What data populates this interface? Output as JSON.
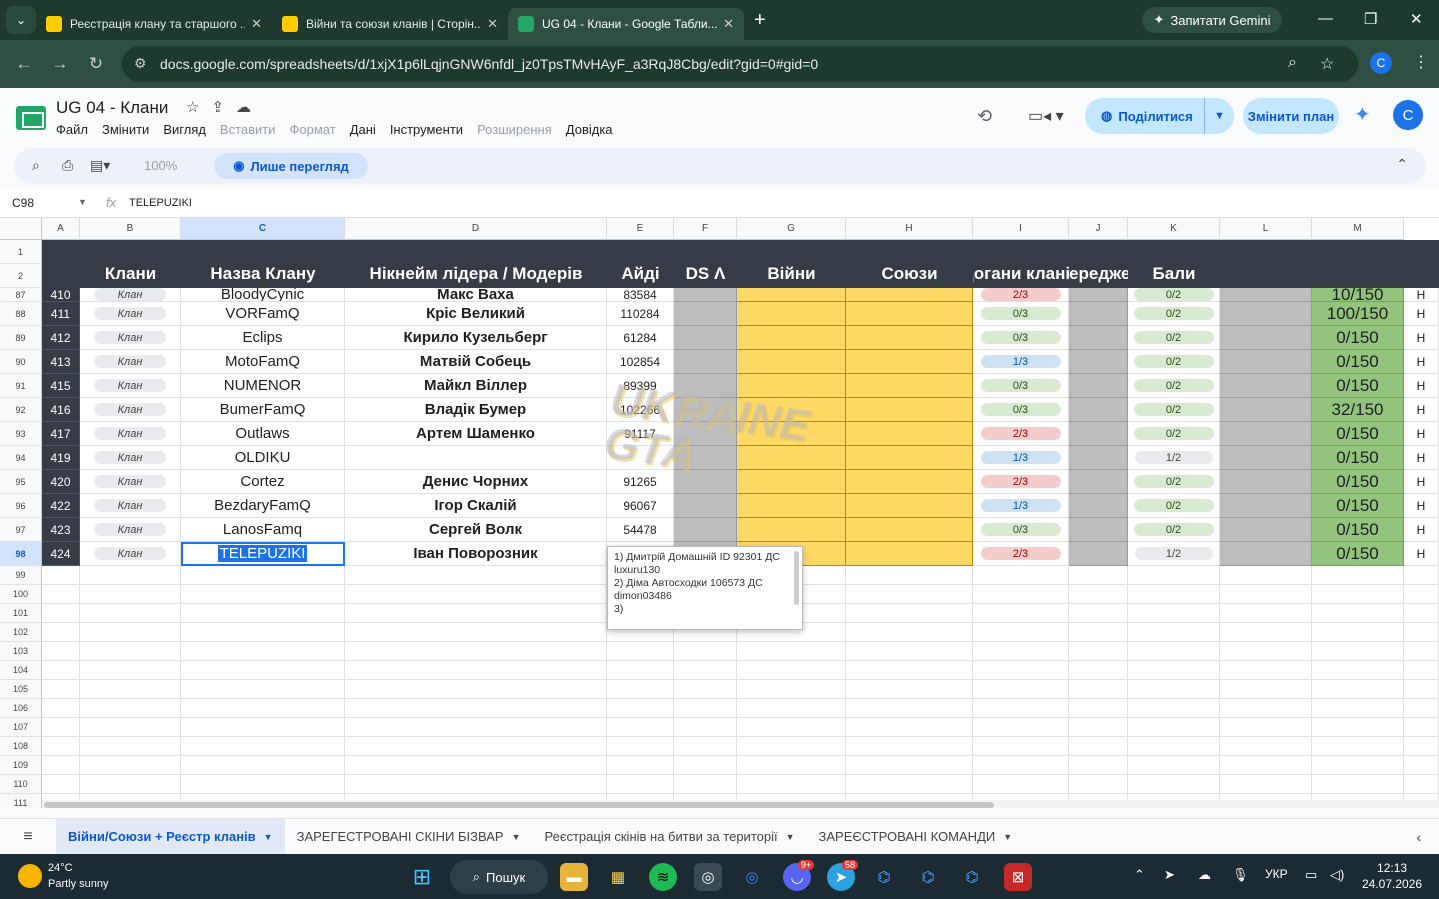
{
  "browser": {
    "tabs": [
      {
        "title": "Реєстрація клану та старшого ...",
        "fav": "#ffcc00"
      },
      {
        "title": "Війни та союзи кланів | Сторін...",
        "fav": "#ffcc00"
      },
      {
        "title": "UG 04 - Клани - Google Табли...",
        "fav": "#23a566"
      }
    ],
    "gemini_label": "Запитати Gemini",
    "url": "docs.google.com/spreadsheets/d/1xjX1p6lLqjnGNW6nfdl_jz0TpsTMvHAyF_a3RqJ8Cbg/edit?gid=0#gid=0",
    "profile_letter": "C"
  },
  "doc": {
    "title": "UG 04 - Клани",
    "menu": [
      {
        "label": "Файл",
        "disabled": false
      },
      {
        "label": "Змінити",
        "disabled": false
      },
      {
        "label": "Вигляд",
        "disabled": false
      },
      {
        "label": "Вставити",
        "disabled": true
      },
      {
        "label": "Формат",
        "disabled": true
      },
      {
        "label": "Дані",
        "disabled": false
      },
      {
        "label": "Інструменти",
        "disabled": false
      },
      {
        "label": "Розширення",
        "disabled": true
      },
      {
        "label": "Довідка",
        "disabled": false
      }
    ],
    "share_label": "Поділитися",
    "plan_label": "Змінити план",
    "avatar_letter": "C",
    "zoom": "100%",
    "view_only_label": "Лише перегляд"
  },
  "formula": {
    "name_box": "C98",
    "fx": "fx",
    "value": "TELEPUZIKI"
  },
  "sheet": {
    "columns": [
      "A",
      "B",
      "C",
      "D",
      "E",
      "F",
      "G",
      "H",
      "I",
      "J",
      "K",
      "L",
      "M"
    ],
    "header_row_numbers": [
      "1",
      "2"
    ],
    "headers": [
      "Клани",
      "Назва Клану",
      "Нікнейм лідера / Модерів",
      "Айді",
      "DS Λ",
      "Війни",
      "Союзи",
      "Догани кланів",
      "Попередження",
      "Бали"
    ],
    "rows": [
      {
        "n": "87",
        "id": "410",
        "type": "Клан",
        "name": "BloodyCynic",
        "leader": "Макс Ваха",
        "aid": "83584",
        "warn": "2/3",
        "warn_kind": "rd",
        "pre": "0/2",
        "score": "10/150"
      },
      {
        "n": "88",
        "id": "411",
        "type": "Клан",
        "name": "VORFamQ",
        "leader": "Кріс Великий",
        "aid": "110284",
        "warn": "0/3",
        "warn_kind": "gr",
        "pre": "0/2",
        "score": "100/150"
      },
      {
        "n": "89",
        "id": "412",
        "type": "Клан",
        "name": "Eclips",
        "leader": "Кирило Кузельберг",
        "aid": "61284",
        "warn": "0/3",
        "warn_kind": "gr",
        "pre": "0/2",
        "score": "0/150"
      },
      {
        "n": "90",
        "id": "413",
        "type": "Клан",
        "name": "MotoFamQ",
        "leader": "Матвій Собець",
        "aid": "102854",
        "warn": "1/3",
        "warn_kind": "bl",
        "pre": "0/2",
        "score": "0/150"
      },
      {
        "n": "91",
        "id": "415",
        "type": "Клан",
        "name": "NUMENOR",
        "leader": "Майкл Віллер",
        "aid": "89399",
        "warn": "0/3",
        "warn_kind": "gr",
        "pre": "0/2",
        "score": "0/150"
      },
      {
        "n": "92",
        "id": "416",
        "type": "Клан",
        "name": "BumerFamQ",
        "leader": "Владік Бумер",
        "aid": "102266",
        "warn": "0/3",
        "warn_kind": "gr",
        "pre": "0/2",
        "score": "32/150"
      },
      {
        "n": "93",
        "id": "417",
        "type": "Клан",
        "name": "Outlaws",
        "leader": "Артем Шаменко",
        "aid": "91117",
        "warn": "2/3",
        "warn_kind": "rd",
        "pre": "0/2",
        "score": "0/150"
      },
      {
        "n": "94",
        "id": "419",
        "type": "Клан",
        "name": "OLDIKU",
        "leader": "",
        "aid": "",
        "warn": "1/3",
        "warn_kind": "bl",
        "pre": "1/2",
        "score": "0/150"
      },
      {
        "n": "95",
        "id": "420",
        "type": "Клан",
        "name": "Cortez",
        "leader": "Денис Чорних",
        "aid": "91265",
        "warn": "2/3",
        "warn_kind": "rd",
        "pre": "0/2",
        "score": "0/150"
      },
      {
        "n": "96",
        "id": "422",
        "type": "Клан",
        "name": "BezdaryFamQ",
        "leader": "Ігор Скалій",
        "aid": "96067",
        "warn": "1/3",
        "warn_kind": "bl",
        "pre": "0/2",
        "score": "0/150"
      },
      {
        "n": "97",
        "id": "423",
        "type": "Клан",
        "name": "LanosFamq",
        "leader": "Сергей Волк",
        "aid": "54478",
        "warn": "0/3",
        "warn_kind": "gr",
        "pre": "0/2",
        "score": "0/150"
      },
      {
        "n": "98",
        "id": "424",
        "type": "Клан",
        "name": "TELEPUZIKI",
        "leader": "Іван Поворозник",
        "aid": "",
        "warn": "2/3",
        "warn_kind": "rd",
        "pre": "1/2",
        "score": "0/150"
      }
    ],
    "empty_rows": [
      "99",
      "100",
      "101",
      "102",
      "103",
      "104",
      "105",
      "106",
      "107",
      "108",
      "109",
      "110",
      "111"
    ],
    "overflow_col_text": "Н",
    "note": "1) Дмитрій Домашній ID 92301 ДС luxuru130\n2) Діма Автосходки 106573 ДС dimon03486\n3)",
    "watermark": "UKRAINE GTA"
  },
  "sheet_tabs": [
    {
      "label": "Війни/Союзи + Реєстр кланів",
      "active": true
    },
    {
      "label": "ЗАРЕГЕСТРОВАНІ СКІНИ БІЗВАР",
      "active": false
    },
    {
      "label": "Реєстрація скінів на битви за території",
      "active": false
    },
    {
      "label": "ЗАРЕЄСТРОВАНІ КОМАНДИ",
      "active": false
    }
  ],
  "taskbar": {
    "temp": "24°C",
    "weather": "Partly sunny",
    "search": "Пошук",
    "lang": "УКР",
    "time": "12:13",
    "date": "24.07.2026",
    "badge_discord": "9+",
    "badge_telegram": "58"
  }
}
